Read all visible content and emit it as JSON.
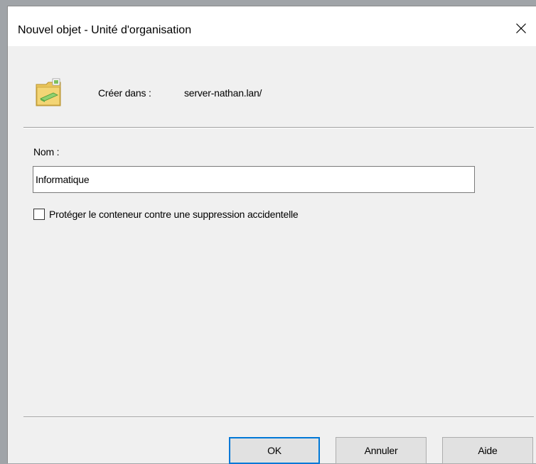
{
  "dialog": {
    "title": "Nouvel objet - Unité d'organisation",
    "close_icon": "close-icon",
    "folder_icon": "organizational-unit-folder-icon",
    "create_in_label": "Créer dans :",
    "create_in_path": "server-nathan.lan/",
    "name_label": "Nom :",
    "name_value": "Informatique",
    "protect_checkbox": {
      "label": "Protéger le conteneur contre une suppression accidentelle",
      "checked": false
    },
    "buttons": {
      "ok": "OK",
      "cancel": "Annuler",
      "help": "Aide"
    }
  },
  "colors": {
    "default_button_border": "#0078d7",
    "dialog_background": "#f0f0f0",
    "titlebar_background": "#ffffff"
  }
}
